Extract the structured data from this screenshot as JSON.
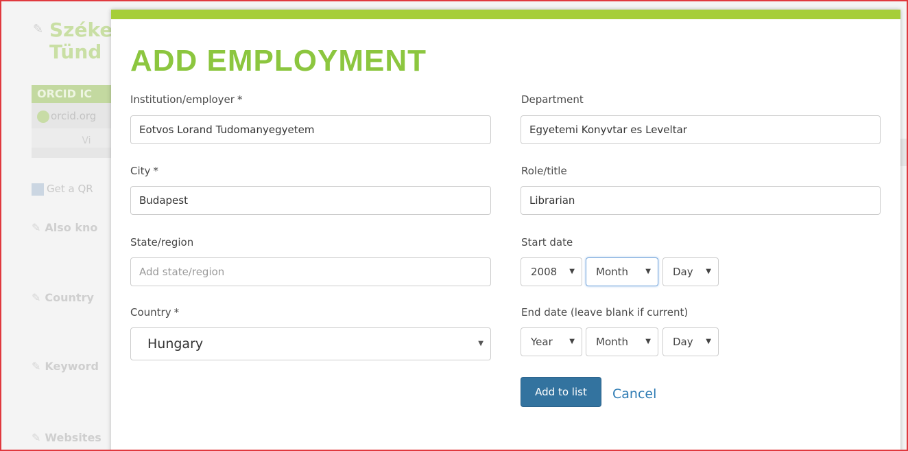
{
  "background": {
    "name_line1": "Széke",
    "name_line2": "Tünd",
    "orcid_heading": "ORCID IC",
    "orcid_url": "orcid.org",
    "orcid_view": "Vi",
    "qr_link": "Get a QR",
    "sections": [
      "Also kno",
      "Country",
      "Keyword",
      "Websites"
    ]
  },
  "modal": {
    "title": "ADD EMPLOYMENT",
    "required_marker": "*",
    "left": {
      "institution": {
        "label": "Institution/employer",
        "value": "Eotvos Lorand Tudomanyegyetem"
      },
      "city": {
        "label": "City",
        "value": "Budapest"
      },
      "state": {
        "label": "State/region",
        "placeholder": "Add state/region"
      },
      "country": {
        "label": "Country",
        "value": "Hungary"
      }
    },
    "right": {
      "department": {
        "label": "Department",
        "value": "Egyetemi Konyvtar es Leveltar"
      },
      "role": {
        "label": "Role/title",
        "value": "Librarian"
      },
      "start_date": {
        "label": "Start date",
        "year": "2008",
        "month": "Month",
        "day": "Day"
      },
      "end_date": {
        "label": "End date (leave blank if current)",
        "year": "Year",
        "month": "Month",
        "day": "Day"
      }
    },
    "buttons": {
      "add": "Add to list",
      "cancel": "Cancel"
    }
  },
  "colors": {
    "accent_green": "#8cc63f",
    "top_bar": "#a6ce39",
    "primary_button": "#33739f",
    "link": "#2f7cb4"
  },
  "icons": {
    "dropdown": "▼",
    "pencil": "✎"
  }
}
